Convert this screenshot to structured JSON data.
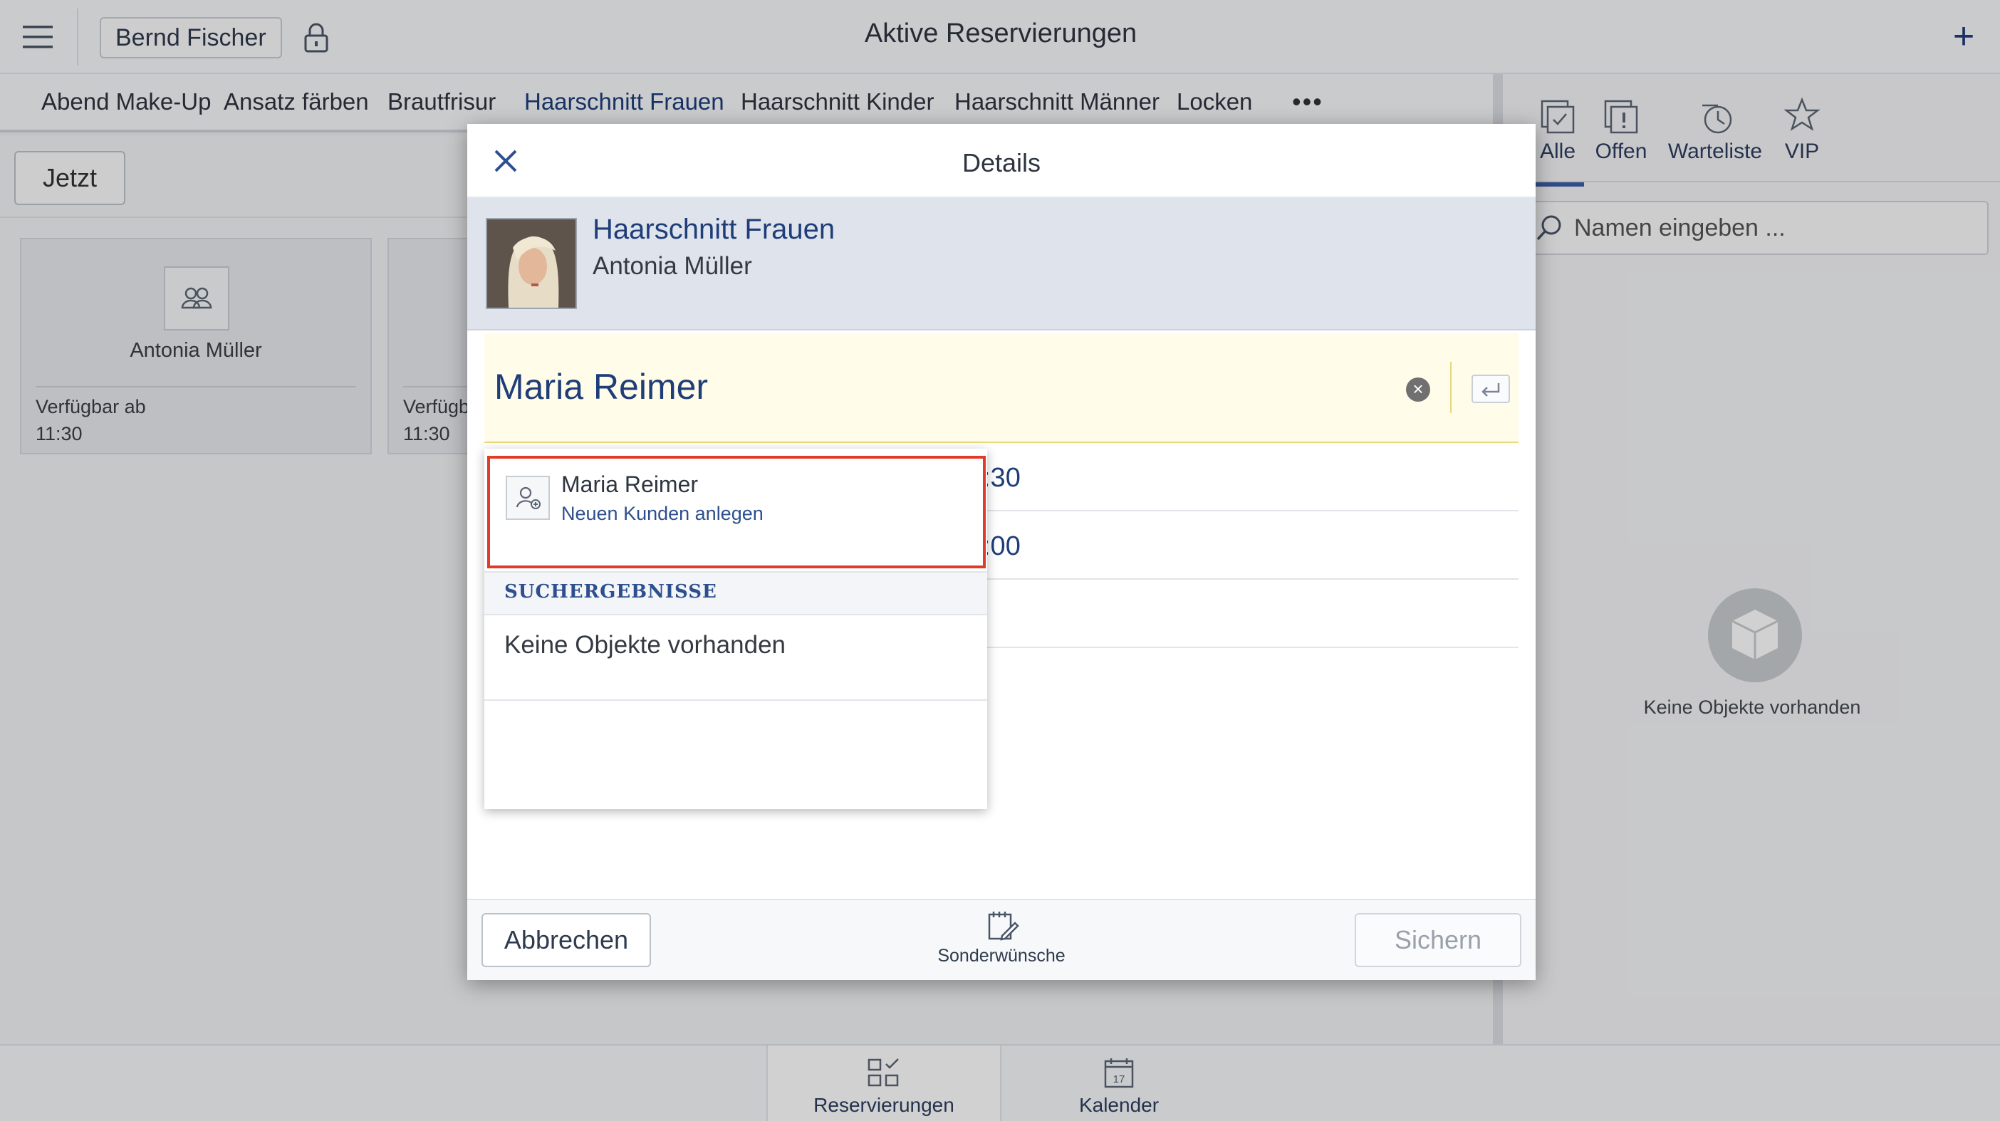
{
  "topbar": {
    "user": "Bernd Fischer",
    "title": "Aktive Reservierungen",
    "add_icon": "plus-icon"
  },
  "categories": [
    {
      "label": "Abend Make-Up"
    },
    {
      "label": "Ansatz färben"
    },
    {
      "label": "Brautfrisur"
    },
    {
      "label": "Haarschnitt Frauen",
      "active": true
    },
    {
      "label": "Haarschnitt Kinder"
    },
    {
      "label": "Haarschnitt Männer"
    },
    {
      "label": "Locken"
    }
  ],
  "categories_more": "•••",
  "left": {
    "now_button": "Jetzt",
    "cards": [
      {
        "name": "Antonia Müller",
        "availability": "Verfügbar ab",
        "time": "11:30"
      },
      {
        "name": "",
        "availability": "Verfügb",
        "time": "11:30"
      }
    ]
  },
  "right_panel": {
    "filter_tabs": [
      {
        "label": "Alle",
        "icon": "all-icon",
        "active": true
      },
      {
        "label": "Offen",
        "icon": "open-icon"
      },
      {
        "label": "Warteliste",
        "icon": "waitlist-clock-icon"
      },
      {
        "label": "VIP",
        "icon": "vip-star-icon"
      }
    ],
    "search_placeholder": "Namen eingeben ...",
    "empty_text": "Keine Objekte vorhanden"
  },
  "modal": {
    "title": "Details",
    "service": "Haarschnitt Frauen",
    "staff": "Antonia Müller",
    "customer_input": "Maria Reimer",
    "time_fragments": [
      ":30",
      ":00"
    ],
    "dropdown": {
      "new_customer_name": "Maria Reimer",
      "new_customer_action": "Neuen Kunden anlegen",
      "results_header": "SUCHERGEBNISSE",
      "no_results": "Keine Objekte vorhanden"
    },
    "footer": {
      "cancel": "Abbrechen",
      "special": "Sonderwünsche",
      "save": "Sichern"
    }
  },
  "bottom_nav": [
    {
      "label": "Reservierungen",
      "active": true
    },
    {
      "label": "Kalender",
      "calendar_day": "17"
    }
  ],
  "colors": {
    "accent": "#1f3d78",
    "highlight_border": "#e23b2a",
    "input_background": "#fffde9"
  }
}
